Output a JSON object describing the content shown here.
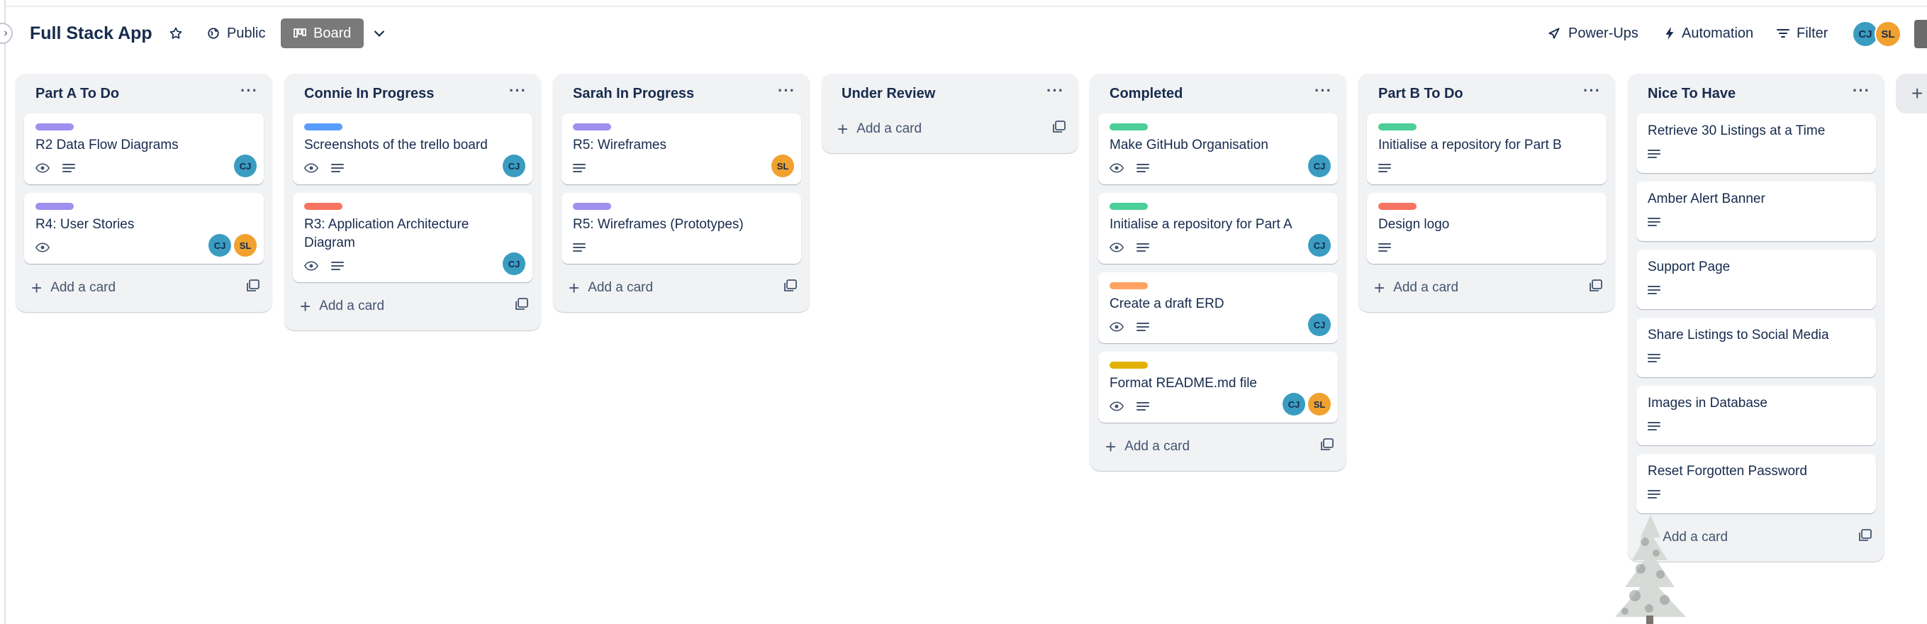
{
  "header": {
    "board_title": "Full Stack App",
    "public_label": "Public",
    "board_label": "Board",
    "powerups_label": "Power-Ups",
    "automation_label": "Automation",
    "filter_label": "Filter",
    "members": [
      "CJ",
      "SL"
    ]
  },
  "colors": {
    "purple": "#9f8fef",
    "blue": "#579dff",
    "red": "#f87462",
    "green": "#4bce97",
    "orange": "#fea362",
    "yellow": "#e2b203",
    "avatar_cj": "#3a9cc1",
    "avatar_sl": "#f0a12e"
  },
  "lists": [
    {
      "title": "Part A To Do",
      "add_label": "Add a card",
      "cards": [
        {
          "title": "R2 Data Flow Diagrams",
          "label": "purple",
          "badges": [
            "eye-icon",
            "description-icon"
          ],
          "members": [
            "CJ"
          ]
        },
        {
          "title": "R4: User Stories",
          "label": "purple",
          "badges": [
            "eye-icon"
          ],
          "members": [
            "CJ",
            "SL"
          ]
        }
      ]
    },
    {
      "title": "Connie In Progress",
      "add_label": "Add a card",
      "cards": [
        {
          "title": "Screenshots of the trello board",
          "label": "blue",
          "badges": [
            "eye-icon",
            "description-icon"
          ],
          "members": [
            "CJ"
          ]
        },
        {
          "title": "R3: Application Architecture Diagram",
          "label": "red",
          "badges": [
            "eye-icon",
            "description-icon"
          ],
          "members": [
            "CJ"
          ]
        }
      ]
    },
    {
      "title": "Sarah In Progress",
      "add_label": "Add a card",
      "cards": [
        {
          "title": "R5: Wireframes",
          "label": "purple",
          "badges": [
            "description-icon"
          ],
          "members": [
            "SL"
          ]
        },
        {
          "title": "R5: Wireframes (Prototypes)",
          "label": "purple",
          "badges": [
            "description-icon"
          ],
          "members": []
        }
      ]
    },
    {
      "title": "Under Review",
      "add_label": "Add a card",
      "cards": []
    },
    {
      "title": "Completed",
      "add_label": "Add a card",
      "cards": [
        {
          "title": "Make GitHub Organisation",
          "label": "green",
          "badges": [
            "eye-icon",
            "description-icon"
          ],
          "members": [
            "CJ"
          ]
        },
        {
          "title": "Initialise a repository for Part A",
          "label": "green",
          "badges": [
            "eye-icon",
            "description-icon"
          ],
          "members": [
            "CJ"
          ]
        },
        {
          "title": "Create a draft ERD",
          "label": "orange",
          "badges": [
            "eye-icon",
            "description-icon"
          ],
          "members": [
            "CJ"
          ]
        },
        {
          "title": "Format README.md file",
          "label": "yellow",
          "badges": [
            "eye-icon",
            "description-icon"
          ],
          "members": [
            "CJ",
            "SL"
          ]
        }
      ]
    },
    {
      "title": "Part B To Do",
      "add_label": "Add a card",
      "cards": [
        {
          "title": "Initialise a repository for Part B",
          "label": "green",
          "badges": [
            "description-icon"
          ],
          "members": []
        },
        {
          "title": "Design logo",
          "label": "red",
          "badges": [
            "description-icon"
          ],
          "members": []
        }
      ]
    },
    {
      "title": "Nice To Have",
      "add_label": "Add a card",
      "cards": [
        {
          "title": "Retrieve 30 Listings at a Time",
          "label": null,
          "badges": [
            "description-icon"
          ],
          "members": []
        },
        {
          "title": "Amber Alert Banner",
          "label": null,
          "badges": [
            "description-icon"
          ],
          "members": []
        },
        {
          "title": "Support Page",
          "label": null,
          "badges": [
            "description-icon"
          ],
          "members": []
        },
        {
          "title": "Share Listings to Social Media",
          "label": null,
          "badges": [
            "description-icon"
          ],
          "members": []
        },
        {
          "title": "Images in Database",
          "label": null,
          "badges": [
            "description-icon"
          ],
          "members": []
        },
        {
          "title": "Reset Forgotten Password",
          "label": null,
          "badges": [
            "description-icon"
          ],
          "members": []
        }
      ]
    }
  ]
}
